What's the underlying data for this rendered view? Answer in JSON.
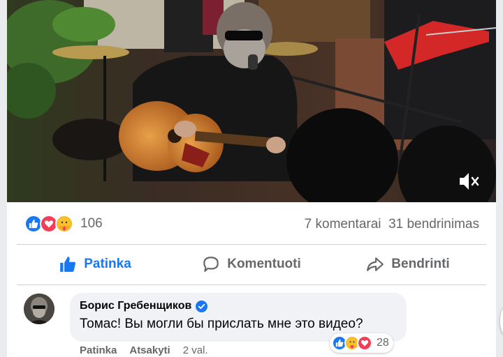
{
  "post": {
    "reactions": {
      "icons": [
        "like-icon",
        "love-icon",
        "care-icon"
      ],
      "count": "106"
    },
    "comments_count": "7 komentarai",
    "shares_count": "31 bendrinimas"
  },
  "actions": {
    "like": "Patinka",
    "comment": "Komentuoti",
    "share": "Bendrinti"
  },
  "comment": {
    "author": "Борис Гребенщиков",
    "verified": true,
    "text": "Томас! Вы могли бы прислать мне это видео?",
    "like_label": "Patinka",
    "reply_label": "Atsakyti",
    "time": "2 val.",
    "reactions": {
      "icons": [
        "like-icon",
        "care-icon",
        "love-icon"
      ],
      "count": "28"
    }
  },
  "colors": {
    "accent": "#1877f2",
    "love": "#f33e58",
    "care": "#f7b125",
    "secondary_text": "#65676b"
  }
}
